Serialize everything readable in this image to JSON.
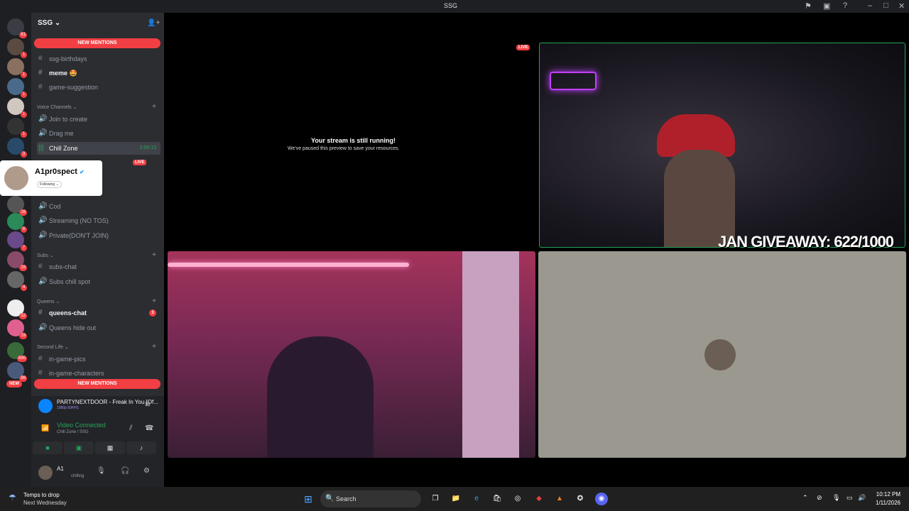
{
  "window": {
    "title": "SSG"
  },
  "guilds": {
    "home_badge": "61",
    "badges": [
      "1",
      "1",
      "1",
      "1",
      "1",
      "3",
      "1",
      "16",
      "6",
      "7",
      "19",
      "4",
      "12",
      "19",
      "690",
      "89"
    ],
    "new_label": "NEW"
  },
  "sidebar": {
    "server_name": "SSG ⌄",
    "new_mentions_top": "NEW MENTIONS",
    "new_mentions_bottom": "NEW MENTIONS",
    "channels_top": [
      {
        "label": "ssg-birthdays",
        "icon": "#"
      },
      {
        "label": "meme 🤩",
        "icon": "#"
      },
      {
        "label": "game-suggestion",
        "icon": "#"
      }
    ],
    "voice_category": "Voice Channels ⌄",
    "voice_channels": [
      {
        "label": "Join to create"
      },
      {
        "label": "Drag me"
      },
      {
        "label": "Chill Zone",
        "time": "2:05:13"
      }
    ],
    "live_tag": "LIVE",
    "more_voice": [
      {
        "label": "Cod"
      },
      {
        "label": "Streaming (NO TOS)"
      },
      {
        "label": "Private(DON'T JOIN)"
      }
    ],
    "subs_category": "Subs ⌄",
    "subs_channels": [
      {
        "label": "subs-chat",
        "icon": "#"
      },
      {
        "label": "Subs chill spot",
        "icon": "voice"
      }
    ],
    "queens_category": "Queens ⌄",
    "queens_channels": [
      {
        "label": "queens-chat",
        "icon": "#",
        "unread": "3"
      },
      {
        "label": "Queens hide out",
        "icon": "voice"
      }
    ],
    "secondlife_category": "Second Life ⌄",
    "secondlife_channels": [
      {
        "label": "in-game-pics",
        "icon": "#"
      },
      {
        "label": "in-game-characters",
        "icon": "#"
      }
    ]
  },
  "profile_card": {
    "name": "A1pr0spect",
    "following": "Following ⌄"
  },
  "now_playing": {
    "title": "PARTYNEXTDOOR - Freak In You [Of...",
    "sub": "1080p 60FPS"
  },
  "voice_connection": {
    "title": "Video Connected",
    "sub": "Chill Zone / SSG"
  },
  "user": {
    "name": "A1",
    "status": "chilling"
  },
  "stage": {
    "paused_title": "Your stream is still running!",
    "paused_sub": "We've paused this preview to save your resources.",
    "live_label": "LIVE",
    "giveaway": "JAN GIVEAWAY: 622/1000"
  },
  "taskbar": {
    "weather_line1": "Temps to drop",
    "weather_line2": "Next Wednesday",
    "search_label": "Search",
    "time": "10:12 PM",
    "date": "1/11/2026"
  },
  "colors": {
    "discord_red": "#f23f43",
    "discord_green": "#23a55a",
    "sidebar_bg": "#2b2d31",
    "guild_bg": "#1e1f22"
  }
}
